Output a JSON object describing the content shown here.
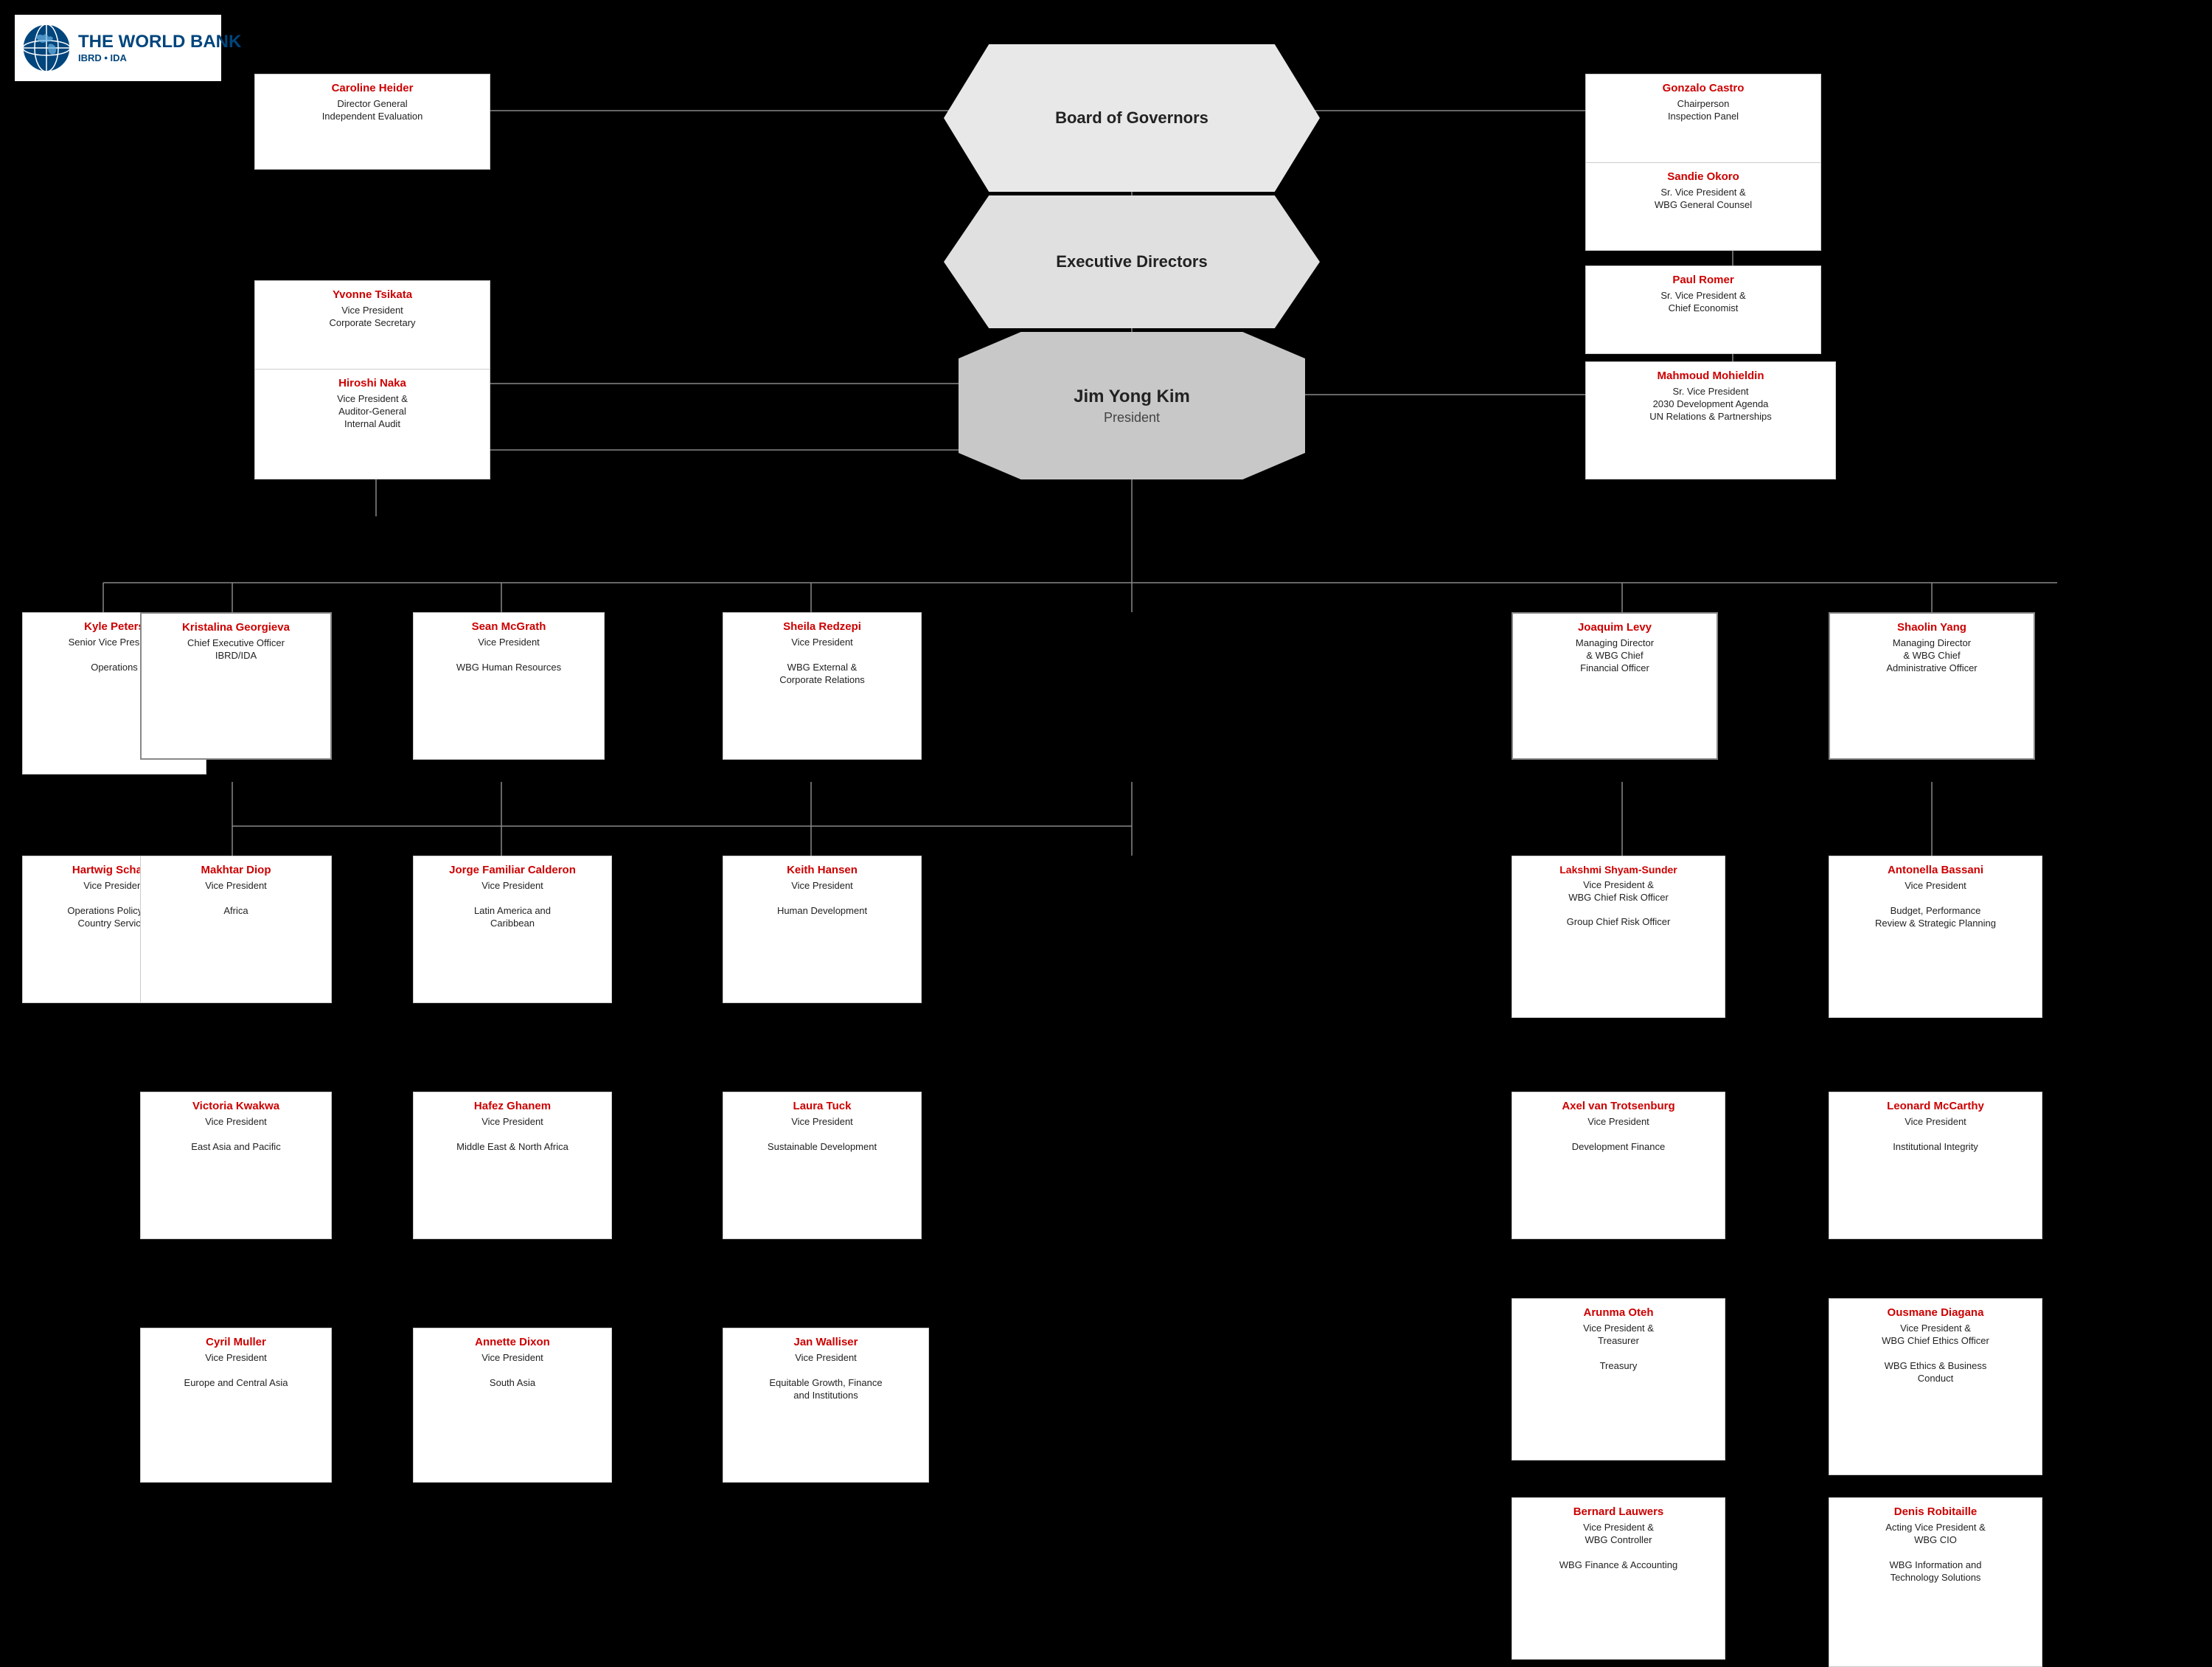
{
  "logo": {
    "main": "THE WORLD BANK",
    "sub": "IBRD • IDA"
  },
  "board": {
    "label": "Board of Governors"
  },
  "exec_directors": {
    "label": "Executive Directors"
  },
  "president": {
    "name": "Jim Yong Kim",
    "title": "President"
  },
  "cards": {
    "caroline": {
      "name": "Caroline Heider",
      "title": "Director General\nIndependent Evaluation"
    },
    "gonzalo": {
      "name": "Gonzalo Castro",
      "title": "Chairperson\nInspection Panel"
    },
    "yvonne": {
      "name": "Yvonne Tsikata",
      "title": "Vice President\nCorporate Secretary"
    },
    "sandie": {
      "name": "Sandie Okoro",
      "title": "Sr. Vice President &\nWBG General Counsel"
    },
    "paul": {
      "name": "Paul Romer",
      "title": "Sr. Vice President &\nChief Economist"
    },
    "hiroshi": {
      "name": "Hiroshi Naka",
      "title": "Vice President &\nAuditor-General\nInternal Audit"
    },
    "mahmoud": {
      "name": "Mahmoud Mohieldin",
      "title": "Sr. Vice President\n2030 Development Agenda\nUN Relations & Partnerships"
    },
    "kyle": {
      "name": "Kyle Peters",
      "title": "Senior Vice President\n\nOperations"
    },
    "kristalina": {
      "name": "Kristalina Georgieva",
      "title": "Chief Executive Officer\nIBRD/IDA"
    },
    "sean": {
      "name": "Sean McGrath",
      "title": "Vice President\n\nWBG Human Resources"
    },
    "sheila": {
      "name": "Sheila Redzepi",
      "title": "Vice President\n\nWBG External &\nCorporate Relations"
    },
    "joaquim": {
      "name": "Joaquim Levy",
      "title": "Managing Director\n& WBG Chief\nFinancial Officer"
    },
    "shaolin": {
      "name": "Shaolin Yang",
      "title": "Managing Director\n& WBG Chief\nAdministrative Officer"
    },
    "hartwig": {
      "name": "Hartwig Schafer",
      "title": "Vice President\n\nOperations Policy and\nCountry Services"
    },
    "makhtar": {
      "name": "Makhtar Diop",
      "title": "Vice President\n\nAfrica"
    },
    "jorge": {
      "name": "Jorge Familiar Calderon",
      "title": "Vice President\n\nLatin America and\nCaribbean"
    },
    "keith": {
      "name": "Keith Hansen",
      "title": "Vice President\n\nHuman Development"
    },
    "lakshmi": {
      "name": "Lakshmi Shyam-Sunder",
      "title": "Vice President &\nWBG Chief Risk Officer\n\nGroup Chief Risk Officer"
    },
    "antonella": {
      "name": "Antonella Bassani",
      "title": "Vice President\n\nBudget, Performance\nReview & Strategic Planning"
    },
    "victoria": {
      "name": "Victoria Kwakwa",
      "title": "Vice President\n\nEast Asia and Pacific"
    },
    "hafez": {
      "name": "Hafez Ghanem",
      "title": "Vice President\n\nMiddle East & North Africa"
    },
    "laura": {
      "name": "Laura Tuck",
      "title": "Vice President\n\nSustainable Development"
    },
    "axel": {
      "name": "Axel van Trotsenburg",
      "title": "Vice President\n\nDevelopment Finance"
    },
    "leonard": {
      "name": "Leonard McCarthy",
      "title": "Vice President\n\nInstitutional Integrity"
    },
    "cyril": {
      "name": "Cyril Muller",
      "title": "Vice President\n\nEurope and Central Asia"
    },
    "annette": {
      "name": "Annette Dixon",
      "title": "Vice President\n\nSouth Asia"
    },
    "jan": {
      "name": "Jan Walliser",
      "title": "Vice President\n\nEquitable Growth, Finance\nand Institutions"
    },
    "arunma": {
      "name": "Arunma Oteh",
      "title": "Vice President &\nTreasurer\n\nTreasury"
    },
    "ousmane": {
      "name": "Ousmane Diagana",
      "title": "Vice President  &\nWBG Chief Ethics Officer\n\nWBG Ethics & Business\nConduct"
    },
    "bernard": {
      "name": "Bernard Lauwers",
      "title": "Vice President &\nWBG Controller\n\nWBG Finance & Accounting"
    },
    "denis": {
      "name": "Denis Robitaille",
      "title": "Acting Vice President &\nWBG CIO\n\nWBG Information and\nTechnology Solutions"
    }
  }
}
